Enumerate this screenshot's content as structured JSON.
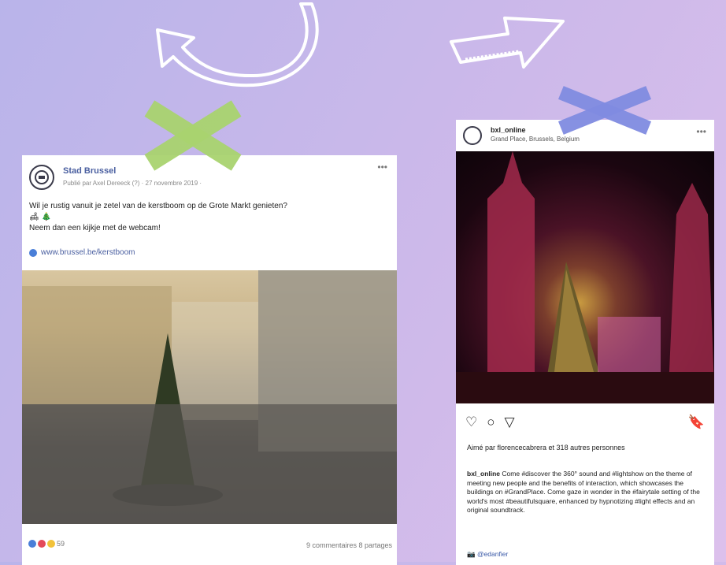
{
  "colors": {
    "green_cross": "#a9d36f",
    "blue_cross": "#7f8be0",
    "fb_link": "#4a5fa0"
  },
  "facebook_post": {
    "page_name": "Stad Brussel",
    "meta": "Publié par Axel Dereeck (?) · 27 novembre 2019 ·",
    "text_line1": "Wil je rustig vanuit je zetel van de kerstboom op de Grote Markt genieten?",
    "text_emoji": "🛋 🎄",
    "text_line2": "Neem dan een kijkje met de webcam!",
    "link": "www.brussel.be/kerstboom",
    "reactions_count": "59",
    "comments_shares": "9 commentaires  8 partages"
  },
  "instagram_post": {
    "username": "bxl_online",
    "location": "Grand Place, Brussels, Belgium",
    "likes_text": "Aimé par florencecabrera et 318 autres personnes",
    "caption": {
      "user": "bxl_online",
      "text": "Come #discover the 360° sound and #lightshow on the theme of meeting new people and the benefits of interaction, which showcases the buildings on #GrandPlace. Come gaze in wonder in the #fairytale setting of the world's most #beautifulsquare, enhanced by hypnotizing #light effects and an original soundtrack."
    },
    "credit": "📷 @edanfier"
  }
}
